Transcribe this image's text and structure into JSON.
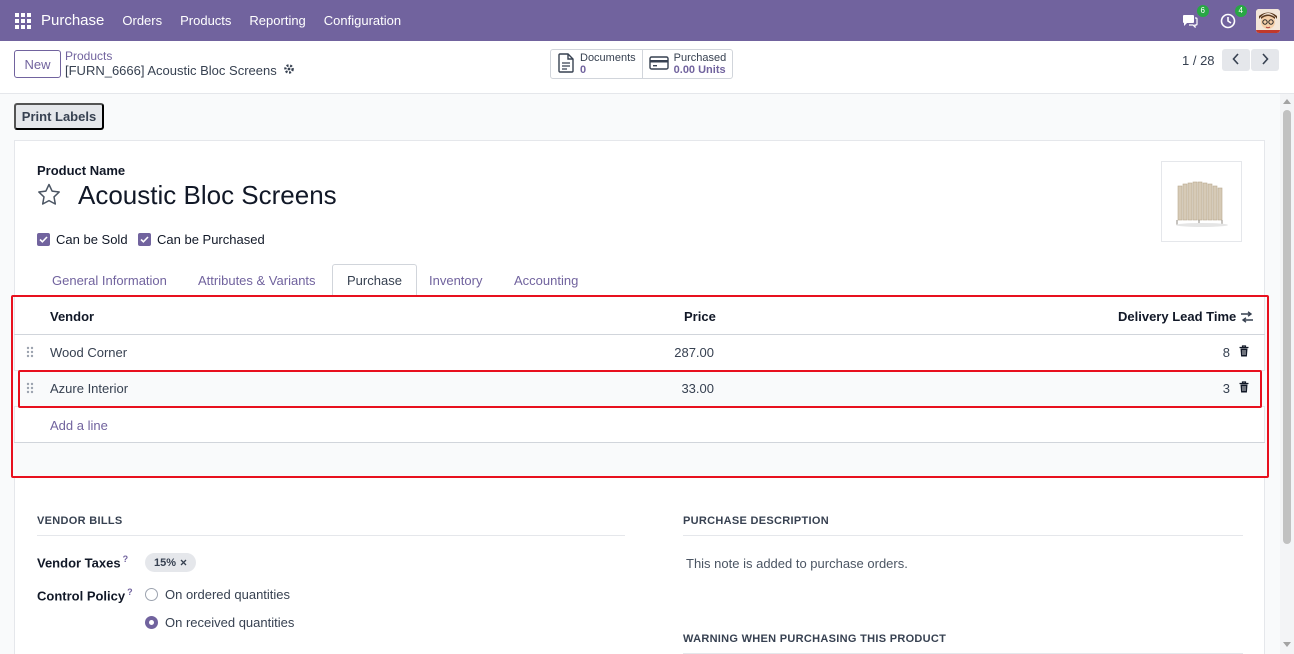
{
  "navbar": {
    "app_name": "Purchase",
    "menu": [
      "Orders",
      "Products",
      "Reporting",
      "Configuration"
    ],
    "messages_badge": "6",
    "activities_badge": "4"
  },
  "control": {
    "new_label": "New",
    "breadcrumb_parent": "Products",
    "breadcrumb_current": "[FURN_6666] Acoustic Bloc Screens",
    "stats": [
      {
        "label": "Documents",
        "value": "0"
      },
      {
        "label": "Purchased",
        "value": "0.00 Units"
      }
    ],
    "pager": "1 / 28"
  },
  "print_labels": "Print Labels",
  "product": {
    "name_label": "Product Name",
    "name": "Acoustic Bloc Screens",
    "can_be_sold": "Can be Sold",
    "can_be_purchased": "Can be Purchased"
  },
  "tabs": [
    "General Information",
    "Attributes & Variants",
    "Purchase",
    "Inventory",
    "Accounting"
  ],
  "vendor_table": {
    "headers": {
      "vendor": "Vendor",
      "price": "Price",
      "lead_time": "Delivery Lead Time"
    },
    "rows": [
      {
        "vendor": "Wood Corner",
        "price": "287.00",
        "lead_time": "8"
      },
      {
        "vendor": "Azure Interior",
        "price": "33.00",
        "lead_time": "3"
      }
    ],
    "add_line": "Add a line"
  },
  "vendor_bills": {
    "title": "VENDOR BILLS",
    "taxes_label": "Vendor Taxes",
    "tooltip_mark": "?",
    "tax_tag": "15%",
    "control_policy_label": "Control Policy",
    "options": [
      "On ordered quantities",
      "On received quantities"
    ]
  },
  "purchase_description": {
    "title": "PURCHASE DESCRIPTION",
    "note": "This note is added to purchase orders."
  },
  "warning_title": "WARNING WHEN PURCHASING THIS PRODUCT",
  "colors": {
    "brand": "#71639e",
    "highlight": "#e8101e"
  }
}
